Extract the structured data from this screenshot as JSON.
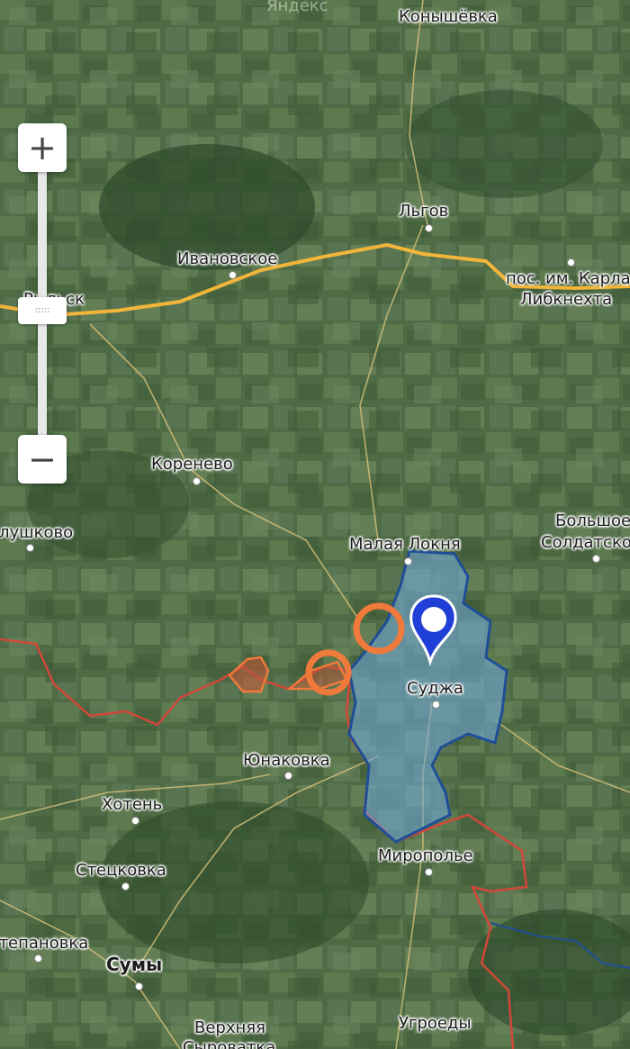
{
  "map": {
    "watermark": "Яндекс",
    "colors": {
      "road": "#f2b53a",
      "controlled_zone_fill": "#6fa6d6",
      "controlled_zone_border": "#1f4e96",
      "border_red": "#d2473a",
      "highlight_ring": "#f07a3c",
      "pin": "#1f3fd6"
    },
    "places": [
      {
        "id": "konyshevka",
        "label": "Конышёвка"
      },
      {
        "id": "lgov",
        "label": "Льгов"
      },
      {
        "id": "ivanovskoe",
        "label": "Ивановское"
      },
      {
        "id": "rylsk",
        "label": "Рыльск"
      },
      {
        "id": "karl-liebknecht-1",
        "label": "пос. им. Карла"
      },
      {
        "id": "karl-liebknecht-2",
        "label": "Либкнехта"
      },
      {
        "id": "korenevo",
        "label": "Коренево"
      },
      {
        "id": "glushkovo",
        "label": "Глушково"
      },
      {
        "id": "malaya-loknya",
        "label": "Малая Локня"
      },
      {
        "id": "bolshoe-1",
        "label": "Большое"
      },
      {
        "id": "bolshoe-2",
        "label": "Солдатское"
      },
      {
        "id": "sudzha",
        "label": "Суджа"
      },
      {
        "id": "yunakovka",
        "label": "Юнаковка"
      },
      {
        "id": "khoten",
        "label": "Хотень"
      },
      {
        "id": "miropolye",
        "label": "Миропольe"
      },
      {
        "id": "stetskovka",
        "label": "Стецковка"
      },
      {
        "id": "stepanovka",
        "label": "Степановка"
      },
      {
        "id": "sumy",
        "label": "Сумы"
      },
      {
        "id": "verkhnyaya-1",
        "label": "Верхняя"
      },
      {
        "id": "verkhnyaya-2",
        "label": "Сыроватка"
      },
      {
        "id": "ugroedy",
        "label": "Угроеды"
      }
    ]
  },
  "controls": {
    "zoom_in_label": "+",
    "zoom_out_label": "−",
    "zoom_handle_label": ":::::",
    "zoom_level": 0.6
  }
}
